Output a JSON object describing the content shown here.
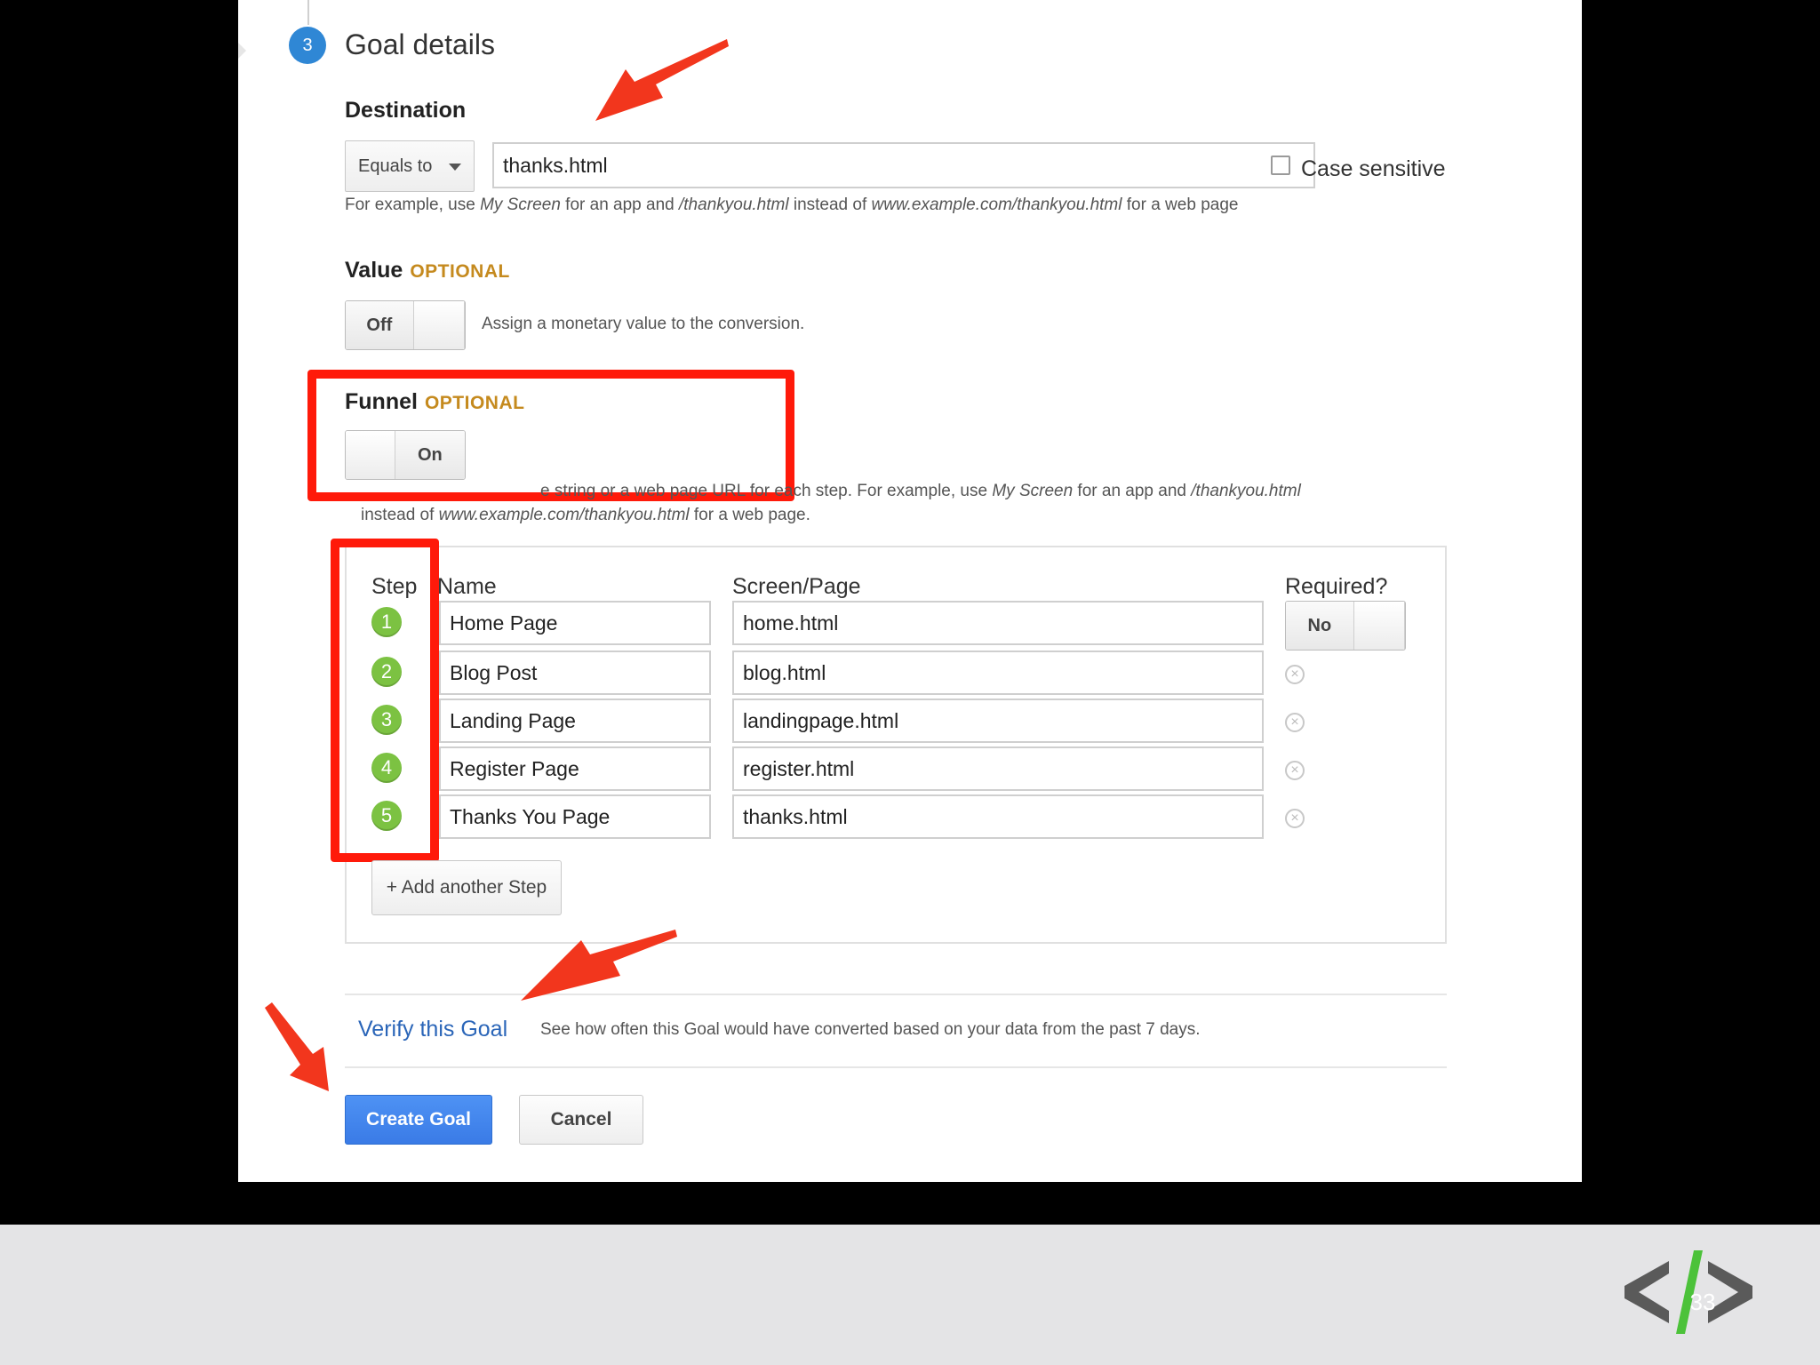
{
  "section": {
    "step_number": "3",
    "title": "Goal details"
  },
  "destination": {
    "label": "Destination",
    "match_type": "Equals to",
    "value": "thanks.html",
    "case_sensitive_label": "Case sensitive",
    "hint": {
      "t1": "For example, use ",
      "e1": "My Screen",
      "t2": " for an app and ",
      "e2": "/thankyou.html",
      "t3": " instead of ",
      "e3": "www.example.com/thankyou.html",
      "t4": " for a web page"
    }
  },
  "value": {
    "label": "Value",
    "optional": "OPTIONAL",
    "toggle": "Off",
    "description": "Assign a monetary value to the conversion."
  },
  "funnel": {
    "label": "Funnel",
    "optional": "OPTIONAL",
    "toggle": "On",
    "hint": {
      "t1": "e string or a web page URL for each step. For example, use ",
      "e1": "My Screen",
      "t2": " for an app and ",
      "e2": "/thankyou.html",
      "t3": "instead of ",
      "e3": "www.example.com/thankyou.html",
      "t4": " for a web page."
    },
    "headers": {
      "step": "Step",
      "name": "Name",
      "screen": "Screen/Page",
      "required": "Required?"
    },
    "required_toggle": "No",
    "steps": [
      {
        "num": "1",
        "name": "Home Page",
        "screen": "home.html"
      },
      {
        "num": "2",
        "name": "Blog Post",
        "screen": "blog.html"
      },
      {
        "num": "3",
        "name": "Landing Page",
        "screen": "landingpage.html"
      },
      {
        "num": "4",
        "name": "Register Page",
        "screen": "register.html"
      },
      {
        "num": "5",
        "name": "Thanks You Page",
        "screen": "thanks.html"
      }
    ],
    "add_step": "+ Add another Step"
  },
  "verify": {
    "link": "Verify this Goal",
    "description": "See how often this Goal would have converted based on your data from the past 7 days."
  },
  "actions": {
    "create": "Create Goal",
    "cancel": "Cancel"
  },
  "footer": {
    "page_number": "33"
  },
  "colors": {
    "accent_red": "#ff1a0a",
    "step_badge": "#7cc242",
    "primary_button": "#3a7be6",
    "section_badge": "#2f87d5"
  }
}
